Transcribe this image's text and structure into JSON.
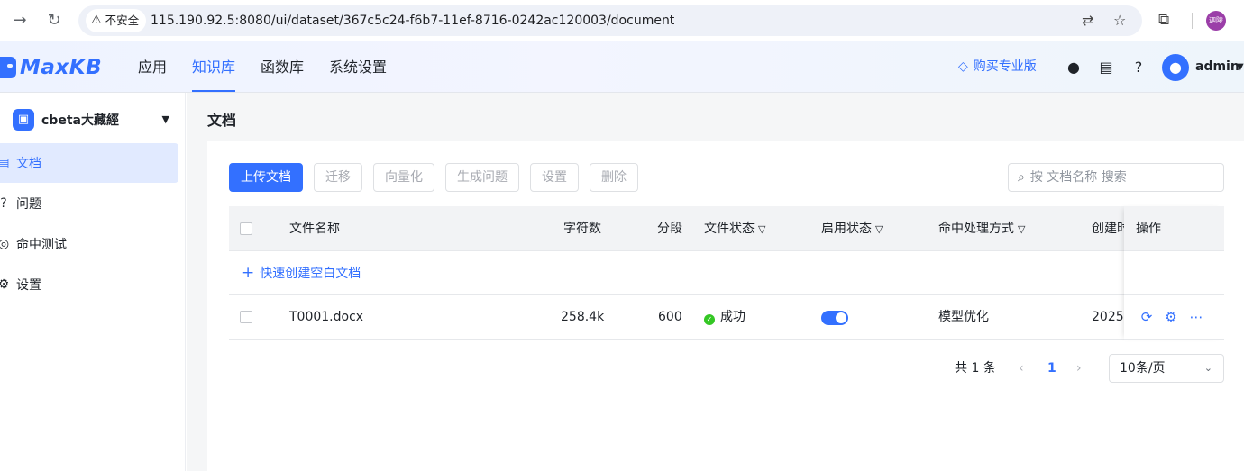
{
  "browser": {
    "security_label": "不安全",
    "url": "115.190.92.5:8080/ui/dataset/367c5c24-f6b7-11ef-8716-0242ac120003/document",
    "profile_label": "迦陵"
  },
  "header": {
    "logo_text": "MaxKB",
    "nav": [
      {
        "label": "应用",
        "active": false
      },
      {
        "label": "知识库",
        "active": true
      },
      {
        "label": "函数库",
        "active": false
      },
      {
        "label": "系统设置",
        "active": false
      }
    ],
    "buy_pro_label": "购买专业版",
    "user_name": "admin",
    "accent_color": "#3370ff"
  },
  "sidebar": {
    "dataset_name": "cbeta大藏經",
    "items": [
      {
        "label": "文档",
        "icon": "document-icon",
        "active": true
      },
      {
        "label": "问题",
        "icon": "question-icon",
        "active": false
      },
      {
        "label": "命中测试",
        "icon": "hit-test-icon",
        "active": false
      },
      {
        "label": "设置",
        "icon": "gear-icon",
        "active": false
      }
    ]
  },
  "main": {
    "title": "文档",
    "toolbar": {
      "upload": "上传文档",
      "migrate": "迁移",
      "vectorize": "向量化",
      "generate_questions": "生成问题",
      "settings": "设置",
      "delete": "删除"
    },
    "search": {
      "placeholder": "按 文档名称 搜索",
      "value": ""
    },
    "table": {
      "columns": {
        "name": "文件名称",
        "chars": "字符数",
        "segments": "分段",
        "file_status": "文件状态",
        "enable_status": "启用状态",
        "hit_handling": "命中处理方式",
        "created": "创建时",
        "ops": "操作"
      },
      "quick_create": "快速创建空白文档",
      "rows": [
        {
          "name": "T0001.docx",
          "chars": "258.4k",
          "segments": "600",
          "status": "成功",
          "enabled": true,
          "hit_handling": "模型优化",
          "created": "2025-"
        }
      ]
    },
    "pagination": {
      "total": "共 1 条",
      "current_page": "1",
      "page_size": "10条/页"
    }
  }
}
